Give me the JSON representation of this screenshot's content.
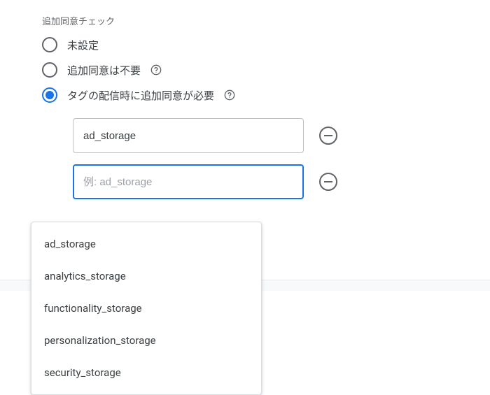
{
  "section": {
    "label": "追加同意チェック"
  },
  "radios": {
    "option1": {
      "label": "未設定"
    },
    "option2": {
      "label": "追加同意は不要"
    },
    "option3": {
      "label": "タグの配信時に追加同意が必要"
    }
  },
  "inputs": {
    "row1": {
      "value": "ad_storage"
    },
    "row2": {
      "placeholder": "例: ad_storage"
    }
  },
  "dropdown": {
    "items": [
      "ad_storage",
      "analytics_storage",
      "functionality_storage",
      "personalization_storage",
      "security_storage"
    ]
  }
}
